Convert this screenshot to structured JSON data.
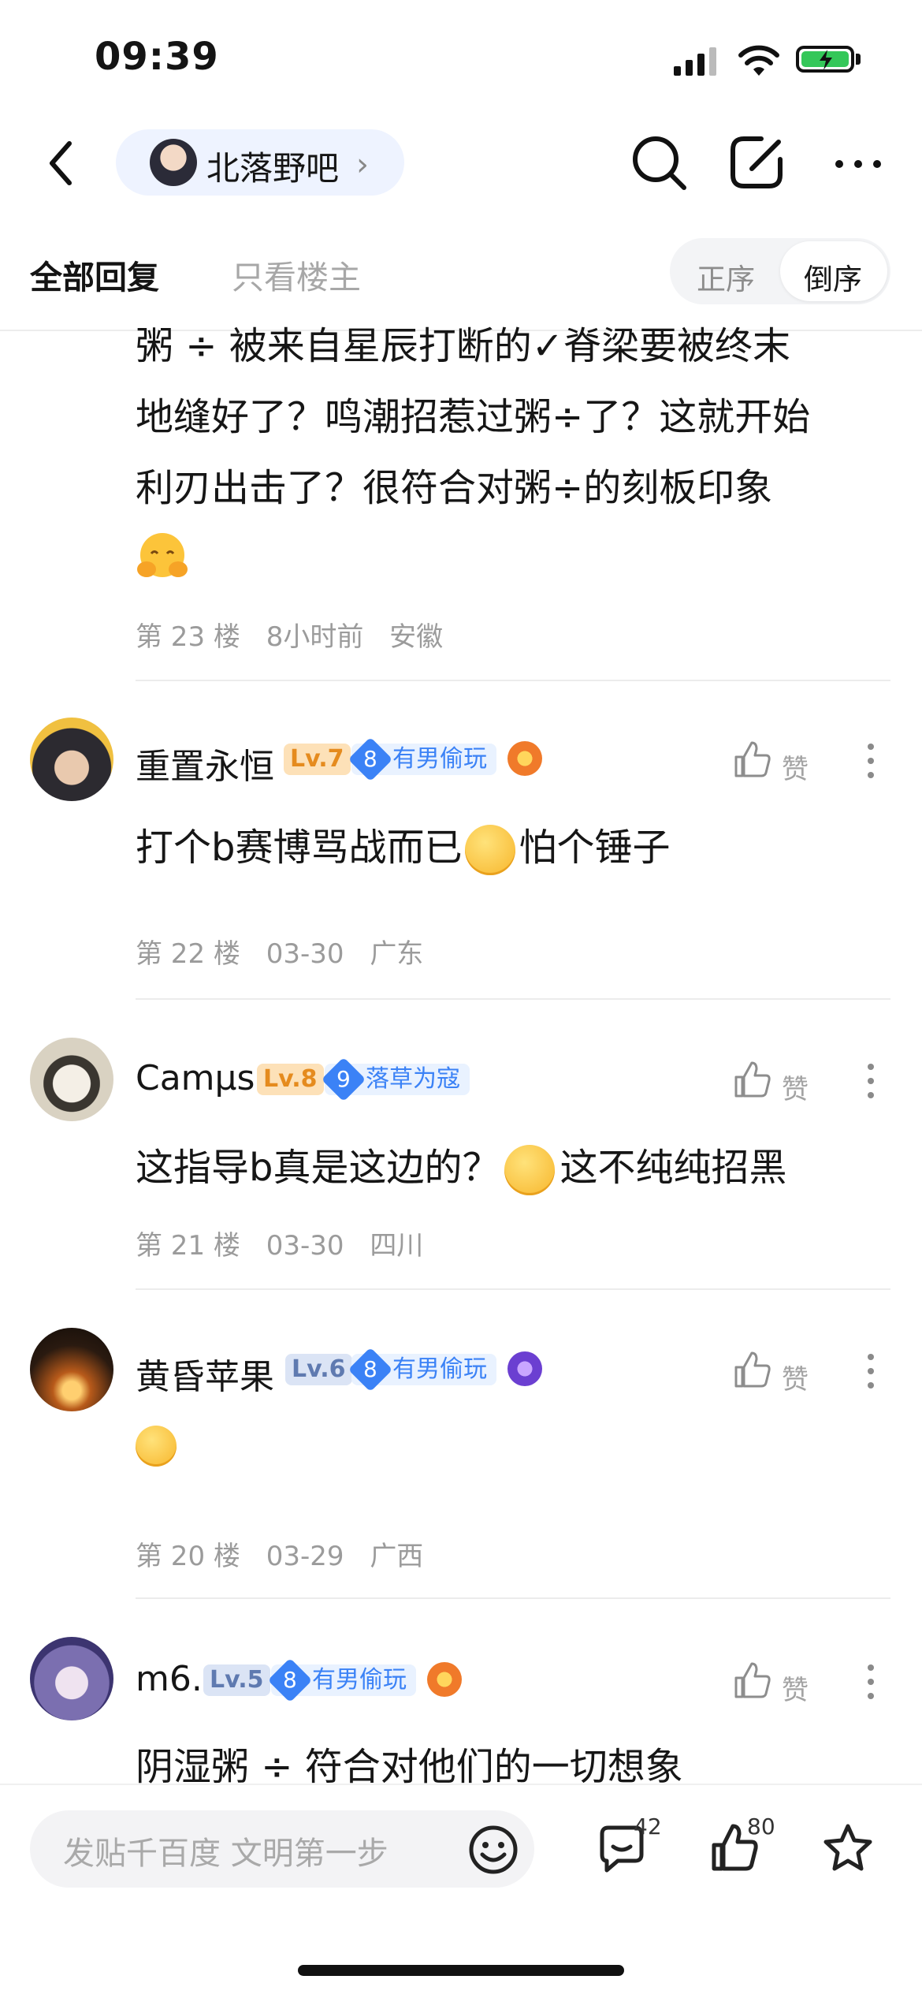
{
  "status_bar": {
    "time": "09:39"
  },
  "header": {
    "forum_name": "北落野吧",
    "chevron": "›"
  },
  "tabs": {
    "all": "全部回复",
    "op_only": "只看楼主",
    "order_asc": "正序",
    "order_desc": "倒序"
  },
  "posts": [
    {
      "lines": [
        "粥 ÷ 被来自星辰打断的✓脊梁要被终末",
        "地缝好了？鸣潮招惹过粥÷了？这就开始",
        "利刃出击了？很符合对粥÷的刻板印象"
      ],
      "meta": [
        "第 23 楼",
        "8小时前",
        "安徽"
      ]
    },
    {
      "username": "重置永恒",
      "level": "Lv.7",
      "tag_num": "8",
      "tag": "有男偷玩",
      "like_label": "赞",
      "text_before": "打个b赛博骂战而已",
      "text_after": "怕个锤子",
      "meta": [
        "第 22 楼",
        "03-30",
        "广东"
      ]
    },
    {
      "username": "Camμs",
      "level": "Lv.8",
      "tag_num": "9",
      "tag": "落草为寇",
      "like_label": "赞",
      "text_before": "这指导b真是这边的？",
      "text_after": "这不纯纯招黑",
      "meta": [
        "第 21 楼",
        "03-30",
        "四川"
      ]
    },
    {
      "username": "黄昏苹果",
      "level": "Lv.6",
      "tag_num": "8",
      "tag": "有男偷玩",
      "like_label": "赞",
      "meta": [
        "第 20 楼",
        "03-29",
        "广西"
      ]
    },
    {
      "username": "m6.",
      "level": "Lv.5",
      "tag_num": "8",
      "tag": "有男偷玩",
      "like_label": "赞",
      "text": "阴湿粥 ÷  符合对他们的一切想象"
    }
  ],
  "bottom_bar": {
    "placeholder": "发贴千百度 文明第一步",
    "comment_count": "42",
    "like_count": "80"
  }
}
